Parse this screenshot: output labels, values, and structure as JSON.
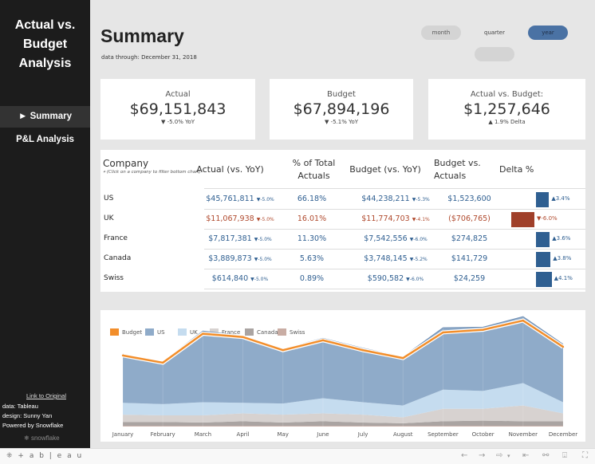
{
  "sidebar": {
    "app_title_lines": [
      "Actual vs.",
      "Budget",
      "Analysis"
    ],
    "nav": [
      {
        "label": "► Summary",
        "active": true
      },
      {
        "label": "P&L Analysis",
        "active": false
      }
    ],
    "link_label": "Link to Original",
    "credits": [
      "data: Tableau",
      "design: Sunny Yan",
      "Powered by Snowflake"
    ],
    "snowflake_label": "snowflake"
  },
  "header": {
    "title": "Summary",
    "subtitle": "data through: December 31, 2018"
  },
  "period_toggle": {
    "options": [
      "month",
      "quarter",
      "year"
    ],
    "selected": "year"
  },
  "kpis": [
    {
      "label": "Actual",
      "value": "$69,151,843",
      "delta_icon": "triangle-down",
      "delta": "▼ -5.0% YoY"
    },
    {
      "label": "Budget",
      "value": "$67,894,196",
      "delta_icon": "triangle-down",
      "delta": "▼ -5.1% YoY"
    },
    {
      "label": "Actual vs. Budget:",
      "value": "$1,257,646",
      "delta_icon": "triangle-up",
      "delta": "▲ 1.9% Delta"
    }
  ],
  "table": {
    "headers": {
      "company": "Company",
      "hint": "(Click on a company to filter bottom chart)",
      "actual_line1": "Actual (vs. YoY)",
      "pct_line1": "% of Total",
      "pct_line2": "Actuals",
      "budget_line1": "Budget (vs. YoY)",
      "bva_line1": "Budget vs.",
      "bva_line2": "Actuals",
      "delta": "Delta %"
    },
    "rows": [
      {
        "company": "US",
        "actual": "$45,761,811",
        "actual_yoy": "▼-5.0%",
        "pct_total": "66.18%",
        "budget": "$44,238,211",
        "budget_yoy": "▼-5.3%",
        "bva": "$1,523,600",
        "delta_pct": 3.4,
        "delta_label": "▲3.4%",
        "status": "positive"
      },
      {
        "company": "UK",
        "actual": "$11,067,938",
        "actual_yoy": "▼-5.0%",
        "pct_total": "16.01%",
        "budget": "$11,774,703",
        "budget_yoy": "▼-4.1%",
        "bva": "($706,765)",
        "delta_pct": -6.0,
        "delta_label": "▼-6.0%",
        "status": "negative"
      },
      {
        "company": "France",
        "actual": "$7,817,381",
        "actual_yoy": "▼-5.0%",
        "pct_total": "11.30%",
        "budget": "$7,542,556",
        "budget_yoy": "▼-6.0%",
        "bva": "$274,825",
        "delta_pct": 3.6,
        "delta_label": "▲3.6%",
        "status": "positive"
      },
      {
        "company": "Canada",
        "actual": "$3,889,873",
        "actual_yoy": "▼-5.0%",
        "pct_total": "5.63%",
        "budget": "$3,748,145",
        "budget_yoy": "▼-5.2%",
        "bva": "$141,729",
        "delta_pct": 3.8,
        "delta_label": "▲3.8%",
        "status": "positive"
      },
      {
        "company": "Swiss",
        "actual": "$614,840",
        "actual_yoy": "▼-5.0%",
        "pct_total": "0.89%",
        "budget": "$590,582",
        "budget_yoy": "▼-6.0%",
        "bva": "$24,259",
        "delta_pct": 4.1,
        "delta_label": "▲4.1%",
        "status": "positive"
      }
    ]
  },
  "colors": {
    "positive": "#2f5f91",
    "negative": "#a0402a",
    "accent_pill": "#4a72a4"
  },
  "chart_data": {
    "type": "area",
    "title": "",
    "xlabel": "",
    "ylabel": "",
    "categories": [
      "January",
      "February",
      "March",
      "April",
      "May",
      "June",
      "July",
      "August",
      "September",
      "October",
      "November",
      "December"
    ],
    "series": [
      {
        "name": "Swiss",
        "color": "#c9ada4",
        "values": [
          0.05,
          0.05,
          0.05,
          0.05,
          0.05,
          0.05,
          0.05,
          0.05,
          0.05,
          0.05,
          0.05,
          0.05
        ]
      },
      {
        "name": "Canada",
        "color": "#aaa4a2",
        "values": [
          0.3,
          0.3,
          0.25,
          0.35,
          0.25,
          0.35,
          0.25,
          0.2,
          0.35,
          0.4,
          0.35,
          0.35
        ]
      },
      {
        "name": "France",
        "color": "#d7d2d0",
        "values": [
          0.55,
          0.5,
          0.55,
          0.6,
          0.6,
          0.6,
          0.6,
          0.45,
          0.95,
          0.9,
          1.2,
          0.6
        ]
      },
      {
        "name": "UK",
        "color": "#c5dcef",
        "values": [
          0.9,
          0.85,
          1.0,
          0.8,
          0.85,
          1.15,
          0.95,
          0.9,
          1.45,
          1.35,
          1.7,
          0.85
        ]
      },
      {
        "name": "US",
        "color": "#8fabc9",
        "values": [
          3.7,
          3.25,
          5.4,
          5.1,
          4.15,
          4.55,
          4.1,
          3.7,
          4.7,
          4.85,
          5.05,
          4.4
        ]
      }
    ],
    "line_series": {
      "name": "Budget",
      "color": "#f28e2b",
      "values": [
        5.4,
        4.85,
        7.05,
        6.8,
        5.8,
        6.55,
        5.8,
        5.2,
        7.15,
        7.35,
        8.05,
        6.05
      ]
    },
    "legend": [
      "Budget",
      "US",
      "UK",
      "France",
      "Canada",
      "Swiss"
    ],
    "legend_placement": "top-left",
    "ylim": [
      0,
      8.6
    ],
    "grid": false
  },
  "legend_colors": {
    "Budget": "#f28e2b",
    "US": "#8fabc9",
    "UK": "#c5dcef",
    "France": "#d7d2d0",
    "Canada": "#aaa4a2",
    "Swiss": "#c9ada4"
  },
  "toolbar": {
    "brand": "+ a b | e a u",
    "icons": [
      "undo-icon",
      "redo-icon",
      "revert-icon",
      "dropdown-icon",
      "reset-icon",
      "share-icon",
      "download-icon",
      "fullscreen-icon"
    ]
  }
}
